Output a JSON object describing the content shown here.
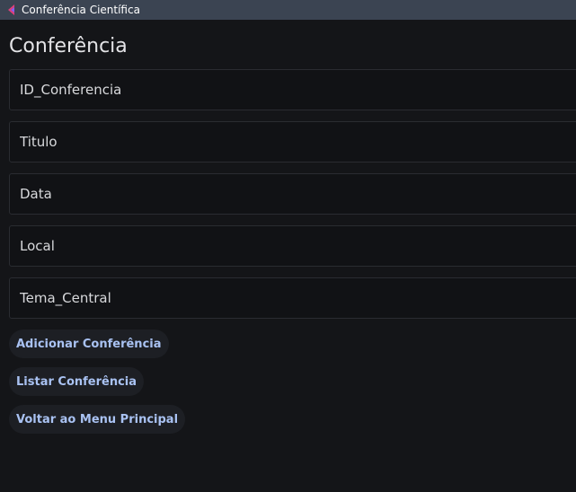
{
  "window": {
    "title": "Conferência Científica",
    "icon": "app-logo-icon"
  },
  "page": {
    "title": "Conferência"
  },
  "fields": [
    {
      "placeholder": "ID_Conferencia",
      "value": ""
    },
    {
      "placeholder": "Titulo",
      "value": ""
    },
    {
      "placeholder": "Data",
      "value": ""
    },
    {
      "placeholder": "Local",
      "value": ""
    },
    {
      "placeholder": "Tema_Central",
      "value": ""
    }
  ],
  "buttons": {
    "add_label": "Adicionar Conferência",
    "list_label": "Listar Conferência",
    "back_label": "Voltar ao Menu Principal"
  },
  "colors": {
    "titlebar": "#3b4452",
    "background": "#141518",
    "field_background": "#111215",
    "button_background": "#1d1f24",
    "button_text": "#a9c2f2",
    "icon_accent": "#e0407a"
  }
}
